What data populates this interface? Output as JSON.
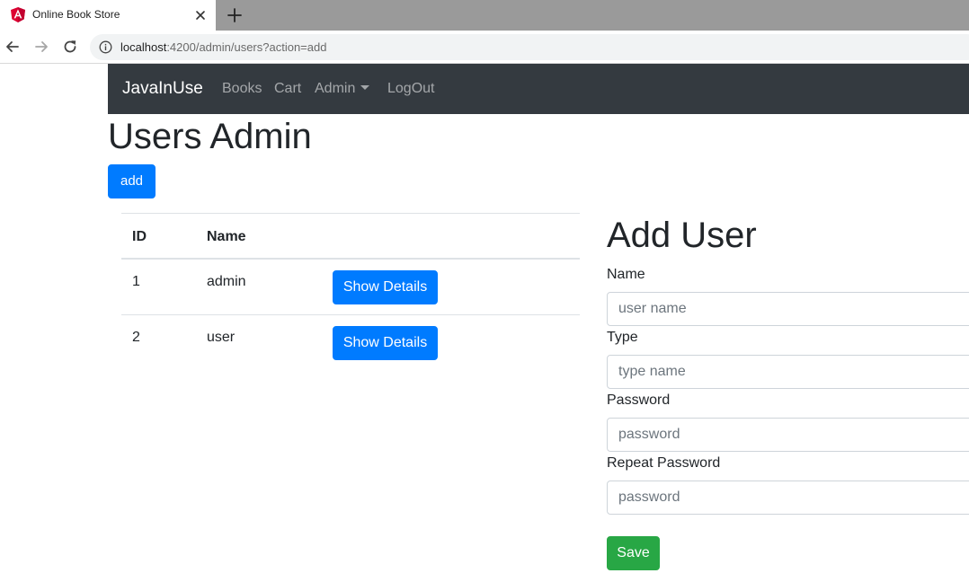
{
  "browser": {
    "tab_title": "Online Book Store",
    "url_host": "localhost",
    "url_rest": ":4200/admin/users?action=add"
  },
  "navbar": {
    "brand": "JavaInUse",
    "links": [
      "Books",
      "Cart",
      "Admin",
      "LogOut"
    ]
  },
  "page": {
    "title": "Users Admin",
    "add_label": "add"
  },
  "table": {
    "headers": [
      "ID",
      "Name"
    ],
    "rows": [
      {
        "id": "1",
        "name": "admin",
        "action": "Show Details"
      },
      {
        "id": "2",
        "name": "user",
        "action": "Show Details"
      }
    ]
  },
  "form": {
    "title": "Add User",
    "fields": [
      {
        "label": "Name",
        "placeholder": "user name"
      },
      {
        "label": "Type",
        "placeholder": "type name"
      },
      {
        "label": "Password",
        "placeholder": "password"
      },
      {
        "label": "Repeat Password",
        "placeholder": "password"
      }
    ],
    "save_label": "Save"
  },
  "colors": {
    "navbar_bg": "#343a40",
    "primary": "#007bff",
    "success": "#28a745",
    "angular_red": "#dd0031"
  },
  "icons": [
    "angular-favicon-icon",
    "close-icon",
    "plus-icon",
    "back-arrow-icon",
    "forward-arrow-icon",
    "reload-icon",
    "info-icon",
    "caret-down-icon"
  ]
}
